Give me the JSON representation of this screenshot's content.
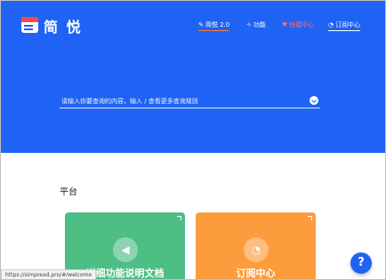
{
  "brand": {
    "name": "简 悦"
  },
  "nav": [
    {
      "label": "简悦 2.0",
      "icon": "rocket-icon"
    },
    {
      "label": "功能",
      "icon": "sparkle-icon"
    },
    {
      "label": "快捷中心",
      "icon": "heart-icon"
    },
    {
      "label": "订阅中心",
      "icon": "rss-icon"
    }
  ],
  "search": {
    "placeholder": "请输入你要查询的内容，输入 / 查看更多查询规则",
    "button_icon": "chevron-down-icon"
  },
  "section": {
    "title": "平台"
  },
  "cards": [
    {
      "label": "详细功能说明文档",
      "icon": "megaphone-icon",
      "color": "#4dbe84"
    },
    {
      "label": "订阅中心",
      "icon": "rss-icon",
      "color": "#fc9c3d"
    }
  ],
  "help": {
    "label": "?"
  },
  "status": {
    "url": "https://simpread.pro/#/welcome"
  },
  "colors": {
    "hero": "#1f63f5",
    "accent": "#ff7b2e"
  }
}
